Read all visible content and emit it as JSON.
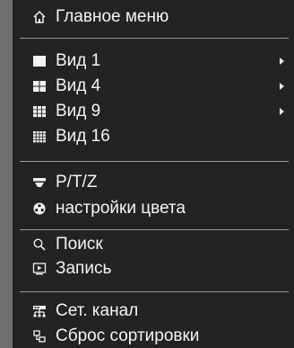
{
  "menu": {
    "items": [
      {
        "label": "Главное меню",
        "icon": "home-icon",
        "submenu": false
      },
      {
        "label": "Вид 1",
        "icon": "single-view-icon",
        "submenu": true
      },
      {
        "label": "Вид 4",
        "icon": "quad-view-icon",
        "submenu": true
      },
      {
        "label": "Вид 9",
        "icon": "nine-view-icon",
        "submenu": true
      },
      {
        "label": "Вид 16",
        "icon": "sixteen-view-icon",
        "submenu": false
      },
      {
        "label": "P/T/Z",
        "icon": "ptz-camera-icon",
        "submenu": false
      },
      {
        "label": "настройки цвета",
        "icon": "color-settings-icon",
        "submenu": false
      },
      {
        "label": "Поиск",
        "icon": "search-icon",
        "submenu": false
      },
      {
        "label": "Запись",
        "icon": "record-icon",
        "submenu": false
      },
      {
        "label": "Сет. канал",
        "icon": "network-channel-icon",
        "submenu": false
      },
      {
        "label": "Сброс сортировки",
        "icon": "reset-sort-icon",
        "submenu": false
      }
    ]
  }
}
